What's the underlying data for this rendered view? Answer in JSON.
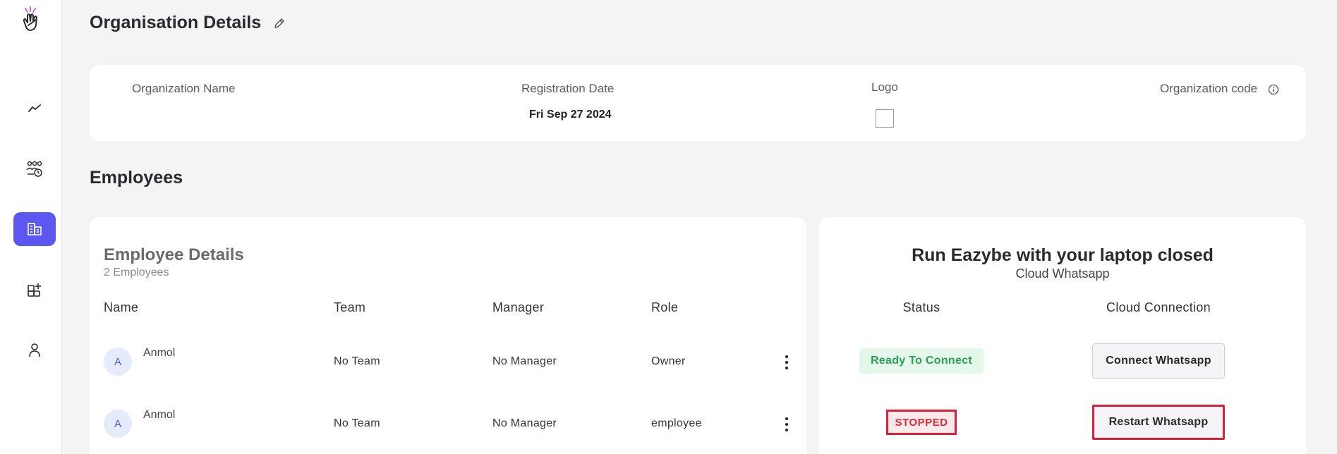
{
  "page": {
    "title": "Organisation Details",
    "employees_section": "Employees"
  },
  "org": {
    "columns": {
      "name": "Organization Name",
      "registration_date": "Registration Date",
      "logo": "Logo",
      "code": "Organization code"
    },
    "registration_date_value": "Fri Sep 27 2024"
  },
  "employees": {
    "title": "Employee Details",
    "count_label": "2 Employees",
    "headers": [
      "Name",
      "Team",
      "Manager",
      "Role"
    ],
    "rows": [
      {
        "initial": "A",
        "name": "Anmol",
        "team": "No Team",
        "manager": "No Manager",
        "role": "Owner"
      },
      {
        "initial": "A",
        "name": "Anmol",
        "team": "No Team",
        "manager": "No Manager",
        "role": "employee"
      }
    ]
  },
  "cloud": {
    "title": "Run Eazybe with your laptop closed",
    "subtitle": "Cloud Whatsapp",
    "headers": {
      "status": "Status",
      "connection": "Cloud Connection"
    },
    "rows": [
      {
        "status": "Ready To Connect",
        "action": "Connect Whatsapp"
      },
      {
        "status": "STOPPED",
        "action": "Restart Whatsapp"
      }
    ]
  },
  "colors": {
    "accent": "#5b57f0",
    "ready": "#2e9e57",
    "stopped": "#d72d3b"
  },
  "icons": [
    "logo-hand-icon",
    "trend-icon",
    "team-icon",
    "building-icon",
    "add-widget-icon",
    "user-icon",
    "pencil-icon",
    "info-icon"
  ]
}
